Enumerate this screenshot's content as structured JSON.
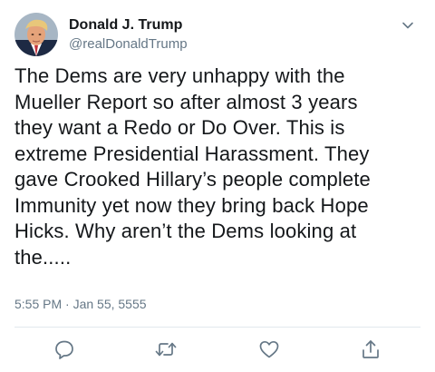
{
  "header": {
    "display_name": "Donald J. Trump",
    "handle": "@realDonaldTrump",
    "avatar_icon": "profile-photo",
    "menu_icon": "chevron-down-icon"
  },
  "tweet": {
    "lines": [
      "The Dems are very unhappy with the",
      "Mueller Report so after almost 3 years",
      "they want a Redo or Do Over. This is",
      "extreme Presidential Harassment. They",
      "gave Crooked Hillary’s people complete",
      "Immunity yet now they bring back Hope",
      "Hicks. Why aren’t the Dems looking at",
      "the....."
    ],
    "timestamp": "5:55 PM · Jan 55, 5555"
  },
  "actions": [
    {
      "name": "reply",
      "icon": "reply-icon"
    },
    {
      "name": "retweet",
      "icon": "retweet-icon"
    },
    {
      "name": "like",
      "icon": "heart-icon"
    },
    {
      "name": "share",
      "icon": "share-icon"
    }
  ],
  "colors": {
    "text": "#14171a",
    "secondary": "#657786",
    "divider": "#e1e8ed"
  }
}
